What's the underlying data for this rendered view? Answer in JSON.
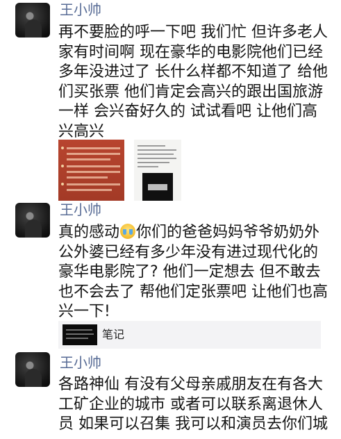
{
  "posts": [
    {
      "username": "王小帅",
      "lines": [
        "再不要脸的呼一下吧 我们忙 但许多老人",
        "家有时间啊 现在豪华的电影院他们已经",
        "多年没进过了 长什么样都不知道了 给他",
        "们买张票 他们肯定会高兴的跟出国旅游",
        "一样 会兴奋好久的 试试看吧 让他们高",
        "兴高兴"
      ]
    },
    {
      "username": "王小帅",
      "lines": [
        [
          "真的感动",
          "你们的爸爸妈妈爷爷奶奶外"
        ],
        "公外婆已经有多少年没有进过现代化的",
        "豪华电影院了? 他们一定想去 但不敢去",
        "也不会去了 帮他们定张票吧 让他们也高",
        "兴一下!"
      ],
      "emoji_icon": "crying-laughing-emoji-icon",
      "note_card": {
        "label": "笔记"
      }
    },
    {
      "username": "王小帅",
      "lines": [
        "各路神仙 有没有父母亲戚朋友在有各大",
        "工矿企业的城市 或者可以联系离退休人",
        "员 如果可以召集 我可以和演员去你们城"
      ]
    }
  ],
  "colors": {
    "username": "#576b95",
    "text": "#141414",
    "note_card_bg": "#f3f3f5",
    "red_image": "#a33a26"
  }
}
